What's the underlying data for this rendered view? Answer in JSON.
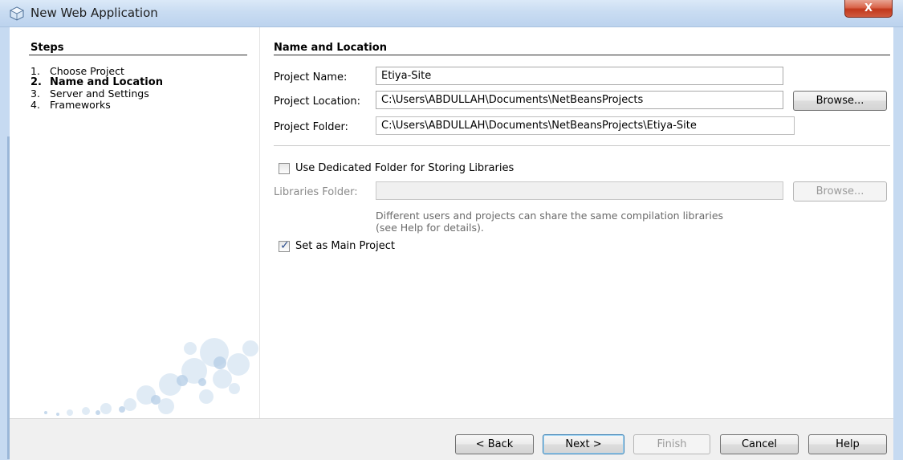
{
  "window": {
    "title": "New Web Application",
    "close_glyph": "X"
  },
  "steps": {
    "title": "Steps",
    "items": [
      {
        "num": "1.",
        "label": "Choose Project"
      },
      {
        "num": "2.",
        "label": "Name and Location"
      },
      {
        "num": "3.",
        "label": "Server and Settings"
      },
      {
        "num": "4.",
        "label": "Frameworks"
      }
    ]
  },
  "panel": {
    "title": "Name and Location",
    "project_name_label": "Project Name:",
    "project_name_value": "Etiya-Site",
    "project_location_label": "Project Location:",
    "project_location_value": "C:\\Users\\ABDULLAH\\Documents\\NetBeansProjects",
    "project_location_browse": "Browse...",
    "project_folder_label": "Project Folder:",
    "project_folder_value": "C:\\Users\\ABDULLAH\\Documents\\NetBeansProjects\\Etiya-Site",
    "dedicated_folder_label": "Use Dedicated Folder for Storing Libraries",
    "dedicated_folder_checked": false,
    "libraries_folder_label": "Libraries Folder:",
    "libraries_folder_value": "",
    "libraries_browse": "Browse...",
    "libraries_help_line1": "Different users and projects can share the same compilation libraries",
    "libraries_help_line2": "(see Help for details).",
    "main_project_label": "Set as Main Project",
    "main_project_checked": true
  },
  "buttons": {
    "back": "< Back",
    "next": "Next >",
    "finish": "Finish",
    "cancel": "Cancel",
    "help": "Help"
  },
  "colors": {
    "titlebar": "#c9dcf2",
    "close": "#c1381c",
    "check": "#2d4f8f"
  },
  "icons": {
    "app": "netbeans-cube-icon",
    "close": "close-icon",
    "check": "check-icon"
  }
}
